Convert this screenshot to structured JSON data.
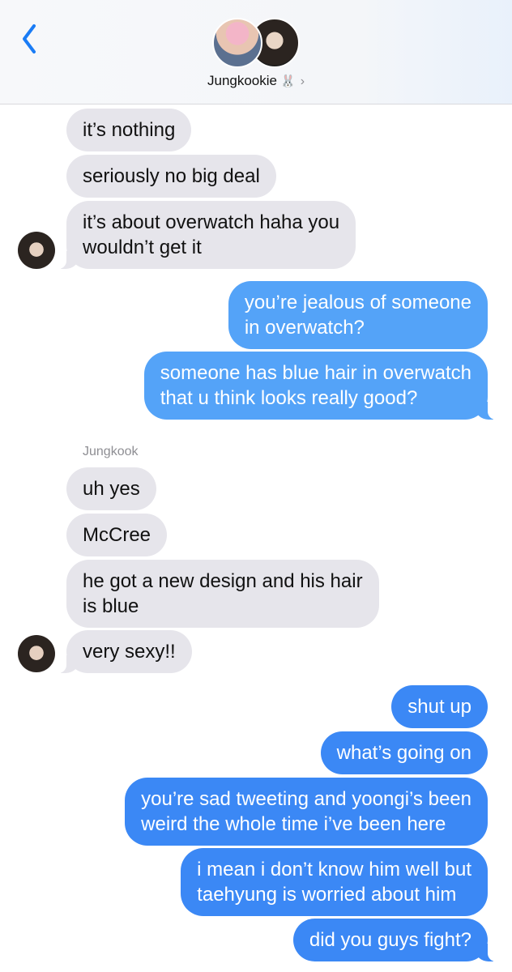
{
  "header": {
    "contact_name": "Jungkookie",
    "contact_emoji": "🐰",
    "chevron": "›",
    "icons": [
      "chevron-left-icon",
      "chevron-right-icon"
    ]
  },
  "messages": [
    {
      "from": "them",
      "text": "it’s nothing"
    },
    {
      "from": "them",
      "text": "seriously no big deal"
    },
    {
      "from": "them",
      "text": "it’s about overwatch haha you wouldn’t get it"
    },
    {
      "from": "me",
      "text": "you’re jealous of someone in overwatch?"
    },
    {
      "from": "me",
      "text": "someone has blue hair in overwatch that u think looks really good?"
    },
    {
      "from": "them",
      "text": "uh yes"
    },
    {
      "from": "them",
      "text": "McCree"
    },
    {
      "from": "them",
      "text": "he got a new design and his hair is blue"
    },
    {
      "from": "them",
      "text": "very sexy!!"
    },
    {
      "from": "me",
      "text": "shut up"
    },
    {
      "from": "me",
      "text": "what’s going on"
    },
    {
      "from": "me",
      "text": "you’re sad tweeting and yoongi’s been weird the whole time i’ve been here"
    },
    {
      "from": "me",
      "text": "i mean i don’t know him well but taehyung is worried about him"
    },
    {
      "from": "me",
      "text": "did you guys fight?"
    }
  ],
  "sender_label": "Jungkook",
  "lines": {
    "m2a": "it’s about overwatch haha you",
    "m2b": "wouldn’t get it",
    "m3a": "you’re jealous of someone",
    "m3b": "in overwatch?",
    "m4a": "someone has blue hair in overwatch",
    "m4b": "that u think looks really good?",
    "m7a": "he got a new design and his hair",
    "m7b": "is blue",
    "m11a": "you’re sad tweeting and yoongi’s been",
    "m11b": "weird the whole time i’ve been here",
    "m12a": "i mean i don’t know him well but",
    "m12b": "taehyung is worried about him"
  },
  "colors": {
    "incoming_bubble": "#e6e5eb",
    "outgoing_bubble": "#3b88f5",
    "accent": "#1a7cf5",
    "meta_text": "#8e8e93"
  }
}
